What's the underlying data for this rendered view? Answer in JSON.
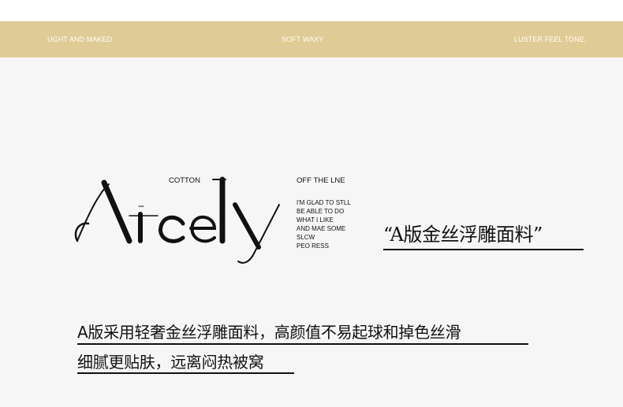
{
  "band": {
    "left": "UGHT AND MAKED",
    "center": "SOFT WAXY",
    "right": "LUSTER FEEL TONE,"
  },
  "logo": {
    "wordmark": "Ately",
    "top_label": "COTTON"
  },
  "side": {
    "heading": "OFF THE LNE",
    "lines": [
      "I'M GLAD TO STLL",
      "BE ABLE TO DO",
      "WHAT I LIKE",
      "AND MAE SOME",
      "SLCW",
      "PEO RESS"
    ]
  },
  "quote": "“A版金丝浮雕面料”",
  "description": {
    "line1": "A版采用轻奢金丝浮雕面料，高颜值不易起球和掉色丝滑",
    "line2": "细腻更贴肤，远离闷热被窝"
  },
  "colors": {
    "band": "#dfcb95",
    "band_text": "#ffffff",
    "main_bg": "#f6f6f6",
    "text": "#111111"
  }
}
